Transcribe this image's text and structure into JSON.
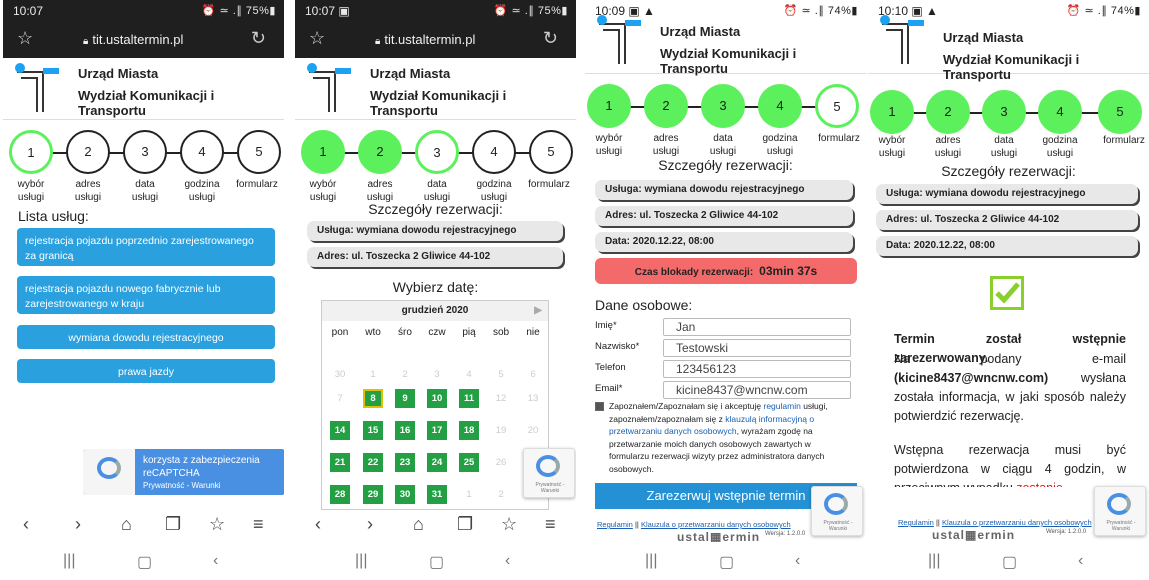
{
  "phones": [
    {
      "status": {
        "time": "10:07",
        "icons": "⏰ ≃ .∥ 75%▮"
      },
      "url": "tit.ustaltermin.pl",
      "header": {
        "line1": "Urząd Miasta",
        "line2": "Wydział Komunikacji i Transportu"
      },
      "steps": [
        {
          "num": "1",
          "l1": "wybór",
          "l2": "usługi"
        },
        {
          "num": "2",
          "l1": "adres",
          "l2": "usługi"
        },
        {
          "num": "3",
          "l1": "data",
          "l2": "usługi"
        },
        {
          "num": "4",
          "l1": "godzina",
          "l2": "usługi"
        },
        {
          "num": "5",
          "l1": "formularz",
          "l2": ""
        }
      ],
      "list_title": "Lista usług:",
      "services": [
        "rejestracja pojazdu poprzednio zarejestrowanego za granicą",
        "rejestracja pojazdu nowego fabrycznie lub zarejestrowanego w kraju",
        "wymiana dowodu rejestracyjnego",
        "prawa jazdy"
      ],
      "recaptcha": {
        "l1": "korzysta z zabezpieczenia",
        "l2": "reCAPTCHA",
        "l3": "Prywatność - Warunki"
      }
    },
    {
      "status": {
        "time": "10:07 ▣",
        "icons": "⏰ ≃ .∥ 75%▮"
      },
      "url": "tit.ustaltermin.pl",
      "details_title": "Szczegóły rezerwacji:",
      "usluga": "Usługa: wymiana dowodu rejestracyjnego",
      "adres": "Adres: ul. Toszecka 2 Gliwice 44-102",
      "choose_date": "Wybierz datę:",
      "month": "grudzień 2020",
      "weekdays": [
        "pon",
        "wto",
        "śro",
        "czw",
        "pią",
        "sob",
        "nie"
      ],
      "weeks": [
        [
          "30",
          "1",
          "2",
          "3",
          "4",
          "5",
          "6"
        ],
        [
          "7",
          "8",
          "9",
          "10",
          "11",
          "12",
          "13"
        ],
        [
          "14",
          "15",
          "16",
          "17",
          "18",
          "19",
          "20"
        ],
        [
          "21",
          "22",
          "23",
          "24",
          "25",
          "26",
          "27"
        ],
        [
          "28",
          "29",
          "30",
          "31",
          "1",
          "2",
          "3"
        ]
      ]
    },
    {
      "status": {
        "time": "10:09 ▣ ▲",
        "icons": "⏰ ≃ .∥ 74%▮"
      },
      "blokady_label": "Czas blokady rezerwacji:",
      "blokady_time": "03min 37s",
      "data": "Data: 2020.12.22, 08:00",
      "dane_title": "Dane osobowe:",
      "fields": [
        {
          "label": "Imię*",
          "value": "Jan"
        },
        {
          "label": "Nazwisko*",
          "value": "Testowski"
        },
        {
          "label": "Telefon",
          "value": "123456123"
        },
        {
          "label": "Email*",
          "value": "kicine8437@wncnw.com"
        }
      ],
      "consent": {
        "p1": "Zapoznałem/Zapoznałam się i akceptuję ",
        "link1": "regulamin",
        "p2": " usługi, zapoznałem/zapoznałam się z ",
        "link2": "klauzulą informacyjną o przetwarzaniu danych osobowych",
        "p3": ", wyrażam zgodę na przetwarzanie moich danych osobowych zawartych w formularzu rezerwacji wizyty przez administratora danych osobowych."
      },
      "submit": "Zarezerwuj wstępnie termin",
      "footer": {
        "regulamin": "Regulamin",
        "sep": "||",
        "klauzula": "Klauzula o przetwarzaniu danych osobowych"
      },
      "brand": "ustal▦ermin",
      "version": "Wersja: 1.2.0.0"
    },
    {
      "status": {
        "time": "10:10 ▣ ▲",
        "icons": "⏰ ≃ .∥ 74%▮"
      },
      "confirm_title": "Termin został wstępnie zarezerwowany.",
      "para1_a": "Na podany e-mail ",
      "para1_email": "(kicine8437@wncnw.com)",
      "para1_b": " wysłana została informacja, w jaki sposób należy potwierdzić rezerwację.",
      "para2_a": "Wstępna rezerwacja musi być potwierdzona w ciągu 4 godzin, w przeciwnym wypadku ",
      "para2_red": "zostanie"
    }
  ],
  "nav": {
    "back": "‹",
    "forward": "›",
    "home": "⌂",
    "tabs": "❐",
    "fav": "☆",
    "menu": "≡"
  },
  "sysnav": {
    "recent": "|||",
    "home": "▢",
    "back": "‹"
  },
  "colors": {
    "step_green": "#5df05d",
    "service_blue": "#2aa0de",
    "cal_green": "#23a043",
    "alert_red": "#f46a6a"
  }
}
